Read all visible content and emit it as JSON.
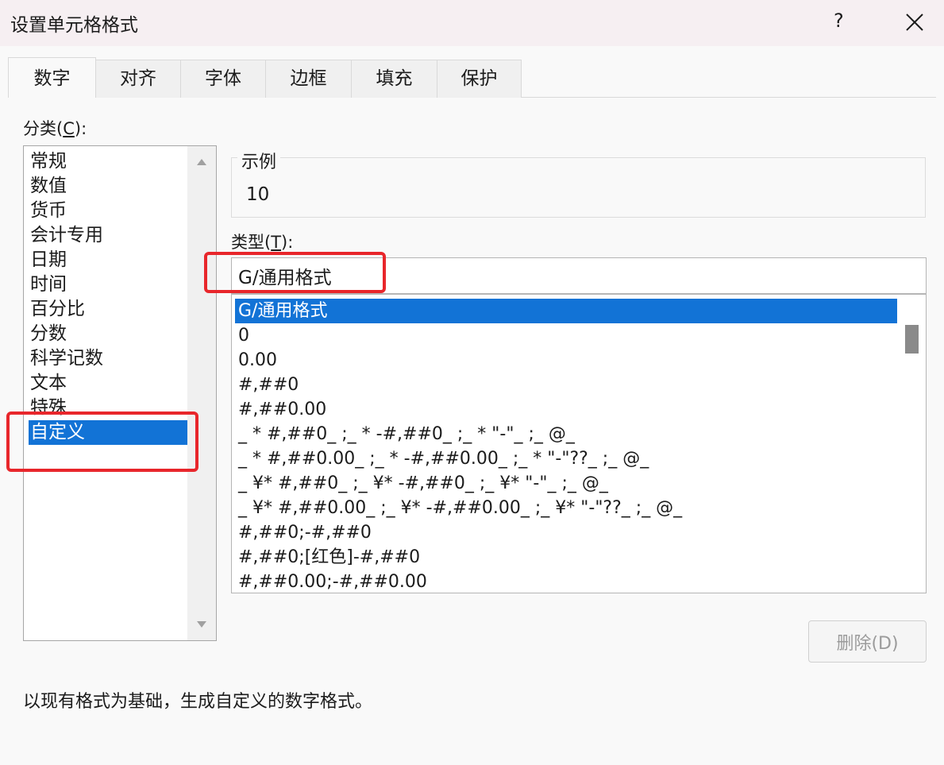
{
  "window": {
    "title": "设置单元格格式",
    "help_label": "?"
  },
  "tabs": [
    {
      "label": "数字",
      "active": true
    },
    {
      "label": "对齐"
    },
    {
      "label": "字体"
    },
    {
      "label": "边框"
    },
    {
      "label": "填充"
    },
    {
      "label": "保护"
    }
  ],
  "category": {
    "label_prefix": "分类(",
    "label_key": "C",
    "label_suffix": "):",
    "items": [
      "常规",
      "数值",
      "货币",
      "会计专用",
      "日期",
      "时间",
      "百分比",
      "分数",
      "科学记数",
      "文本",
      "特殊",
      "自定义"
    ],
    "selected": "自定义"
  },
  "sample": {
    "legend": "示例",
    "value": "10"
  },
  "type": {
    "label_prefix": "类型(",
    "label_key": "T",
    "label_suffix": "):",
    "input_value": "G/通用格式",
    "formats": [
      "G/通用格式",
      "0",
      "0.00",
      "#,##0",
      "#,##0.00",
      "_ * #,##0_ ;_ * -#,##0_ ;_ * \"-\"_ ;_ @_",
      "_ * #,##0.00_ ;_ * -#,##0.00_ ;_ * \"-\"??_ ;_ @_",
      "_ ¥* #,##0_ ;_ ¥* -#,##0_ ;_ ¥* \"-\"_ ;_ @_",
      "_ ¥* #,##0.00_ ;_ ¥* -#,##0.00_ ;_ ¥* \"-\"??_ ;_ @_",
      "#,##0;-#,##0",
      "#,##0;[红色]-#,##0",
      "#,##0.00;-#,##0.00"
    ],
    "selected": "G/通用格式"
  },
  "buttons": {
    "delete_label": "删除(D)"
  },
  "description": "以现有格式为基础，生成自定义的数字格式。",
  "colors": {
    "selection": "#1273d6",
    "highlight_box": "#e8262b",
    "titlebar": "#f6eff2"
  }
}
